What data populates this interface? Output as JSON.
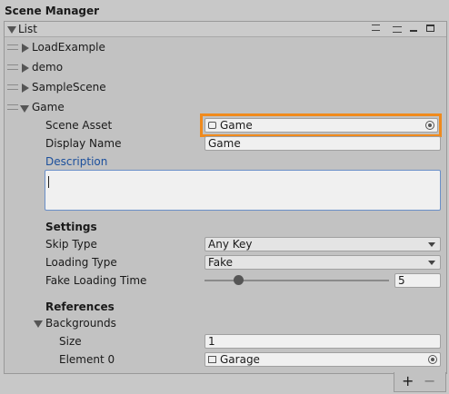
{
  "window": {
    "title": "Scene Manager"
  },
  "list": {
    "header_label": "List",
    "header_icons": [
      "list-icon",
      "menu-icon",
      "minimize-icon",
      "maximize-icon"
    ],
    "items": [
      {
        "label": "LoadExample"
      },
      {
        "label": "demo"
      },
      {
        "label": "SampleScene"
      },
      {
        "label": "Game"
      }
    ]
  },
  "game": {
    "scene_asset_label": "Scene Asset",
    "scene_asset_value": "Game",
    "display_name_label": "Display Name",
    "display_name_value": "Game",
    "description_label": "Description",
    "description_value": ""
  },
  "settings": {
    "heading": "Settings",
    "skip_type_label": "Skip Type",
    "skip_type_value": "Any Key",
    "loading_type_label": "Loading Type",
    "loading_type_value": "Fake",
    "fake_time_label": "Fake Loading Time",
    "fake_time_value": "5",
    "fake_time_fraction": 0.18
  },
  "references": {
    "heading": "References",
    "backgrounds_label": "Backgrounds",
    "size_label": "Size",
    "size_value": "1",
    "element0_label": "Element 0",
    "element0_value": "Garage"
  },
  "footer": {
    "add_label": "+",
    "remove_label": "−"
  },
  "colors": {
    "highlight": "#f08a1c",
    "description_label": "#1b4f9c",
    "panel": "#c2c2c2"
  }
}
